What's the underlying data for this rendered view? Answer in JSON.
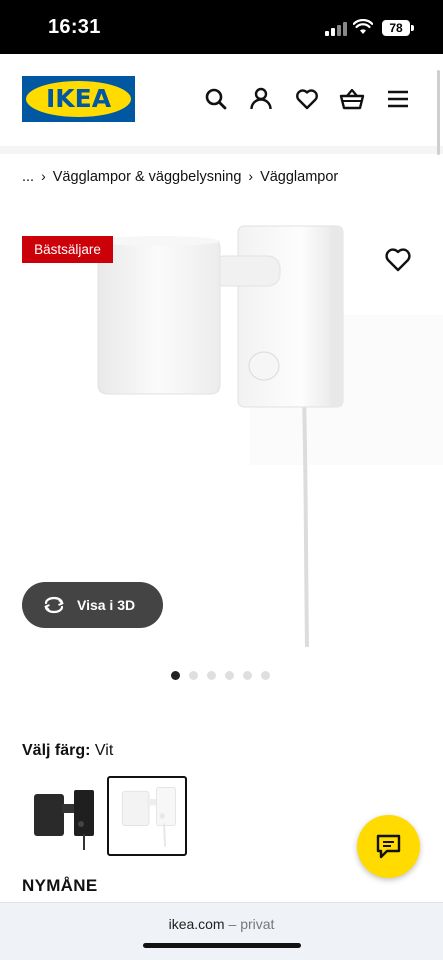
{
  "status_bar": {
    "time": "16:31",
    "battery": "78"
  },
  "header": {
    "logo_text": "IKEA",
    "icons": [
      "search-icon",
      "user-icon",
      "heart-icon",
      "basket-icon",
      "menu-icon"
    ]
  },
  "breadcrumb": {
    "items": [
      "...",
      "Vägglampor & väggbelysning",
      "Vägglampor"
    ]
  },
  "product": {
    "badge": "Bästsäljare",
    "view_3d_label": "Visa i 3D",
    "image_count": 6,
    "active_image": 1,
    "color_label": "Välj färg:",
    "color_value": "Vit",
    "swatches": [
      "black",
      "white"
    ],
    "selected_swatch": "white",
    "name": "NYMÅNE"
  },
  "browser": {
    "domain": "ikea.com",
    "separator": "–",
    "mode": "privat"
  },
  "colors": {
    "ikea_blue": "#0058A3",
    "ikea_yellow": "#FFDB00",
    "badge_red": "#CC0008"
  }
}
